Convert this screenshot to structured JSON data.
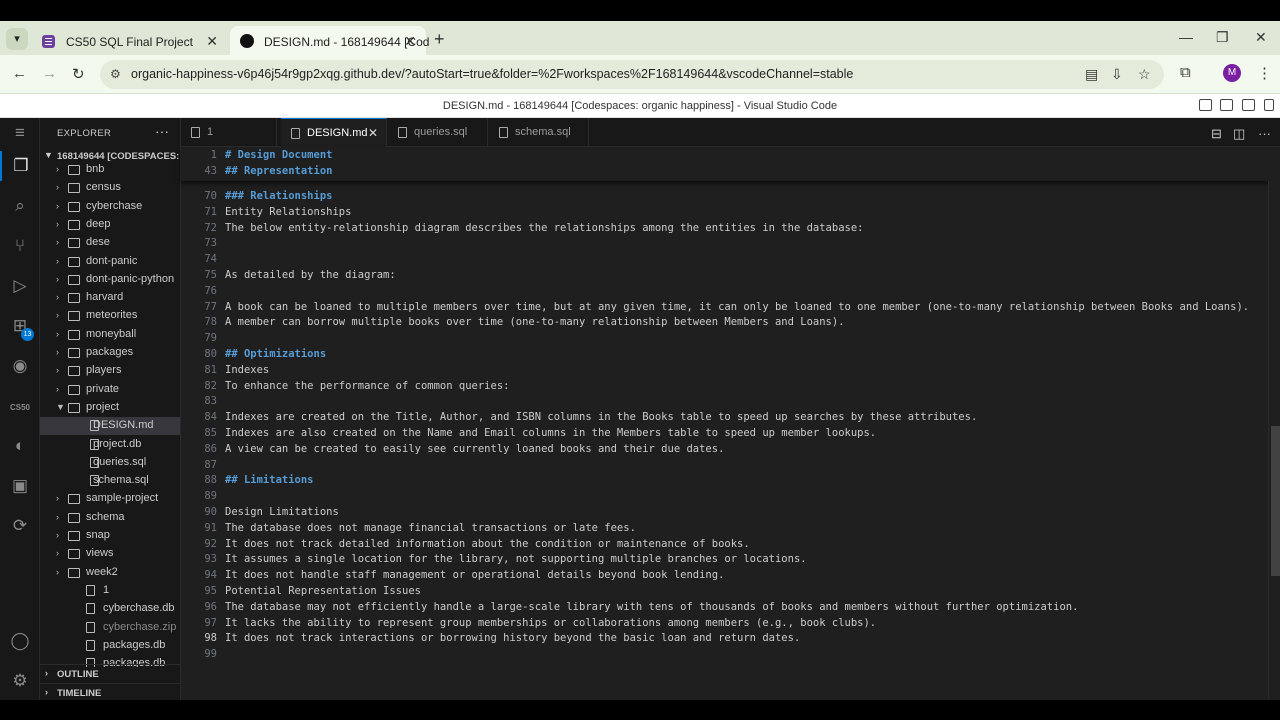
{
  "browser": {
    "tabs": [
      {
        "title": "CS50 SQL Final Project",
        "icon": "cs50-favicon"
      },
      {
        "title": "DESIGN.md - 168149644 [Cod",
        "icon": "github-favicon",
        "active": true
      }
    ],
    "url": "organic-happiness-v6p46j54r9gp2xqg.github.dev/?autoStart=true&folder=%2Fworkspaces%2F168149644&vscodeChannel=stable",
    "profile_initial": "M"
  },
  "vscode": {
    "window_title": "DESIGN.md - 168149644 [Codespaces: organic happiness] - Visual Studio Code",
    "activity_badge": "13",
    "activity_label": "CS50",
    "explorer": {
      "header": "EXPLORER",
      "workspace": "168149644 [CODESPACES: ...",
      "items": [
        {
          "label": "bnb",
          "type": "folder"
        },
        {
          "label": "census",
          "type": "folder"
        },
        {
          "label": "cyberchase",
          "type": "folder"
        },
        {
          "label": "deep",
          "type": "folder"
        },
        {
          "label": "dese",
          "type": "folder"
        },
        {
          "label": "dont-panic",
          "type": "folder"
        },
        {
          "label": "dont-panic-python",
          "type": "folder"
        },
        {
          "label": "harvard",
          "type": "folder"
        },
        {
          "label": "meteorites",
          "type": "folder"
        },
        {
          "label": "moneyball",
          "type": "folder"
        },
        {
          "label": "packages",
          "type": "folder"
        },
        {
          "label": "players",
          "type": "folder"
        },
        {
          "label": "private",
          "type": "folder"
        },
        {
          "label": "project",
          "type": "folder-open"
        },
        {
          "label": "DESIGN.md",
          "type": "file",
          "depth": 2,
          "selected": true
        },
        {
          "label": "project.db",
          "type": "file",
          "depth": 2
        },
        {
          "label": "queries.sql",
          "type": "file",
          "depth": 2
        },
        {
          "label": "schema.sql",
          "type": "file",
          "depth": 2
        },
        {
          "label": "sample-project",
          "type": "folder"
        },
        {
          "label": "schema",
          "type": "folder"
        },
        {
          "label": "snap",
          "type": "folder"
        },
        {
          "label": "views",
          "type": "folder"
        },
        {
          "label": "week2",
          "type": "folder"
        },
        {
          "label": "1",
          "type": "file"
        },
        {
          "label": "cyberchase.db",
          "type": "file"
        },
        {
          "label": "cyberchase.zip",
          "type": "file",
          "dim": true
        },
        {
          "label": "packages.db",
          "type": "file"
        },
        {
          "label": "packages.db",
          "type": "file"
        }
      ],
      "outline": "OUTLINE",
      "timeline": "TIMELINE"
    },
    "editor_tabs": [
      {
        "label": "1"
      },
      {
        "label": "DESIGN.md",
        "active": true
      },
      {
        "label": "queries.sql"
      },
      {
        "label": "schema.sql"
      }
    ],
    "sticky_lines": [
      {
        "num": "1",
        "text": "# Design Document",
        "heading": true
      },
      {
        "num": "43",
        "text": "## Representation",
        "heading": true
      }
    ],
    "lines": [
      {
        "num": "70",
        "text": "### Relationships",
        "heading": true
      },
      {
        "num": "71",
        "text": "Entity Relationships"
      },
      {
        "num": "72",
        "text": "The below entity-relationship diagram describes the relationships among the entities in the database:"
      },
      {
        "num": "73",
        "text": ""
      },
      {
        "num": "74",
        "text": ""
      },
      {
        "num": "75",
        "text": "As detailed by the diagram:"
      },
      {
        "num": "76",
        "text": ""
      },
      {
        "num": "77",
        "text": "A book can be loaned to multiple members over time, but at any given time, it can only be loaned to one member (one-to-many relationship between Books and Loans)."
      },
      {
        "num": "78",
        "text": "A member can borrow multiple books over time (one-to-many relationship between Members and Loans)."
      },
      {
        "num": "79",
        "text": ""
      },
      {
        "num": "80",
        "text": "## Optimizations",
        "heading": true
      },
      {
        "num": "81",
        "text": "Indexes"
      },
      {
        "num": "82",
        "text": "To enhance the performance of common queries:"
      },
      {
        "num": "83",
        "text": ""
      },
      {
        "num": "84",
        "text": "Indexes are created on the Title, Author, and ISBN columns in the Books table to speed up searches by these attributes."
      },
      {
        "num": "85",
        "text": "Indexes are also created on the Name and Email columns in the Members table to speed up member lookups."
      },
      {
        "num": "86",
        "text": "A view can be created to easily see currently loaned books and their due dates."
      },
      {
        "num": "87",
        "text": ""
      },
      {
        "num": "88",
        "text": "## Limitations",
        "heading": true
      },
      {
        "num": "89",
        "text": ""
      },
      {
        "num": "90",
        "text": "Design Limitations"
      },
      {
        "num": "91",
        "text": "The database does not manage financial transactions or late fees."
      },
      {
        "num": "92",
        "text": "It does not track detailed information about the condition or maintenance of books."
      },
      {
        "num": "93",
        "text": "It assumes a single location for the library, not supporting multiple branches or locations."
      },
      {
        "num": "94",
        "text": "It does not handle staff management or operational details beyond book lending."
      },
      {
        "num": "95",
        "text": "Potential Representation Issues"
      },
      {
        "num": "96",
        "text": "The database may not efficiently handle a large-scale library with tens of thousands of books and members without further optimization."
      },
      {
        "num": "97",
        "text": "It lacks the ability to represent group memberships or collaborations among members (e.g., book clubs)."
      },
      {
        "num": "98",
        "text": "It does not track interactions or borrowing history beyond the basic loan and return dates.",
        "current": true
      },
      {
        "num": "99",
        "text": ""
      }
    ]
  }
}
